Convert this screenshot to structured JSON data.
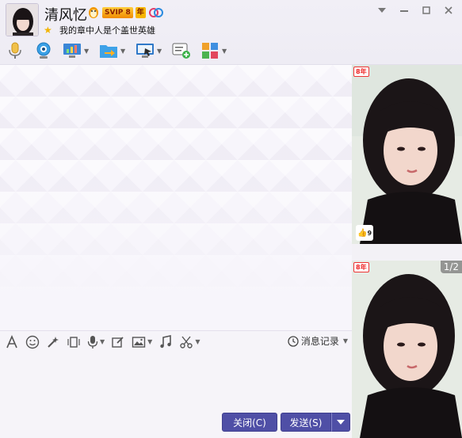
{
  "header": {
    "contact_name": "清风忆",
    "svip_badge": "SVIP 8",
    "year_badge": "年",
    "signature": "我的章中人是个盖世英雄"
  },
  "window_controls": [
    "▾",
    "–",
    "□",
    "✕"
  ],
  "toolbar": {
    "items": [
      {
        "icon": "microphone-icon",
        "has_dropdown": false
      },
      {
        "icon": "webcam-icon",
        "has_dropdown": false
      },
      {
        "icon": "remote-desktop-icon",
        "has_dropdown": true
      },
      {
        "icon": "file-transfer-icon",
        "has_dropdown": true
      },
      {
        "icon": "screen-share-icon",
        "has_dropdown": true
      },
      {
        "icon": "group-chat-icon",
        "has_dropdown": false
      },
      {
        "icon": "apps-icon",
        "has_dropdown": true
      }
    ]
  },
  "input_toolbar": {
    "history_label": "消息记录"
  },
  "actions": {
    "close_label": "关闭(C)",
    "send_label": "发送(S)"
  },
  "right_panel": {
    "vip_tag": "8年",
    "like_count": "9",
    "page_indicator": "1/2"
  }
}
